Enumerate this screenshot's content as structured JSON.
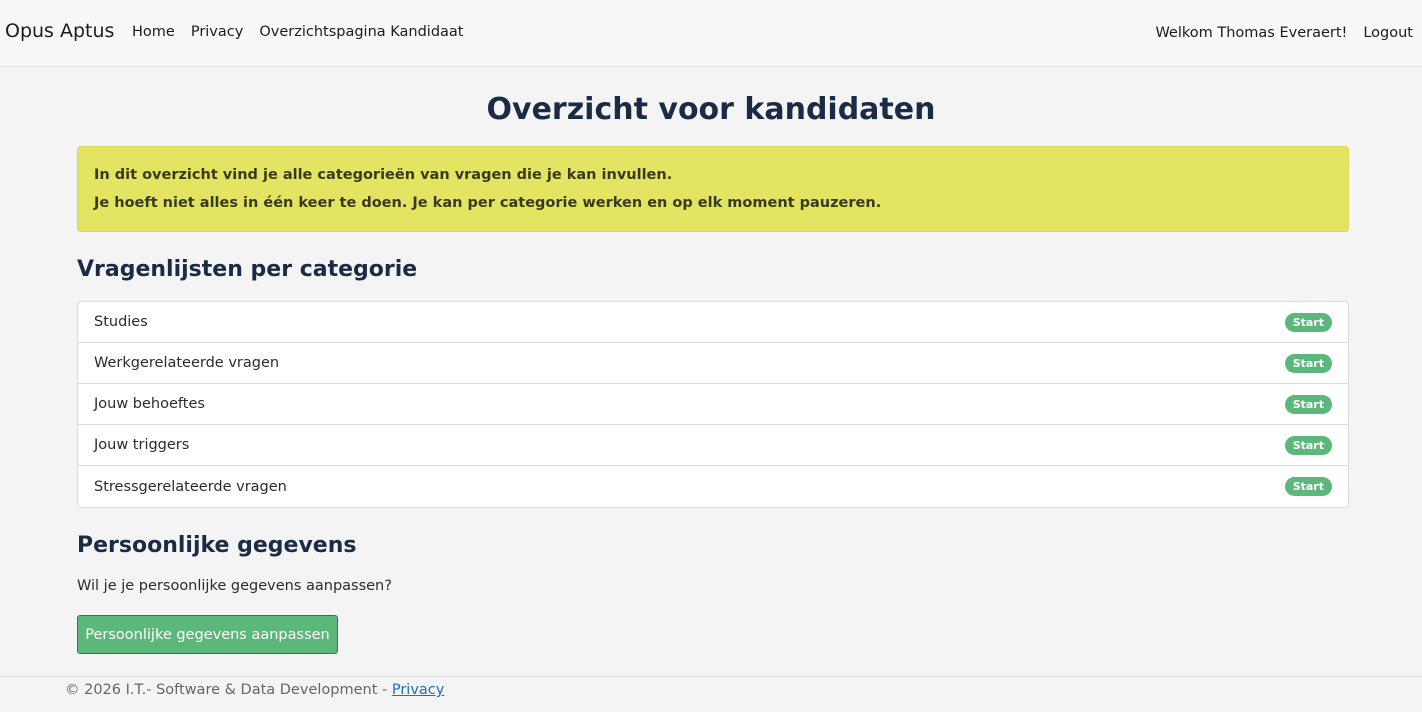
{
  "navbar": {
    "brand": "Opus Aptus",
    "links": [
      "Home",
      "Privacy",
      "Overzichtspagina Kandidaat"
    ],
    "welcome": "Welkom Thomas Everaert!",
    "logout": "Logout"
  },
  "main": {
    "title": "Overzicht voor kandidaten",
    "alert": {
      "line1": "In dit overzicht vind je alle categorieën van vragen die je kan invullen.",
      "line2": "Je hoeft niet alles in één keer te doen. Je kan per categorie werken en op elk moment pauzeren."
    },
    "categories_heading": "Vragenlijsten per categorie",
    "categories": [
      {
        "label": "Studies",
        "badge": "Start"
      },
      {
        "label": "Werkgerelateerde vragen",
        "badge": "Start"
      },
      {
        "label": "Jouw behoeftes",
        "badge": "Start"
      },
      {
        "label": "Jouw triggers",
        "badge": "Start"
      },
      {
        "label": "Stressgerelateerde vragen",
        "badge": "Start"
      }
    ],
    "personal_heading": "Persoonlijke gegevens",
    "personal_question": "Wil je je persoonlijke gegevens aanpassen?",
    "personal_button": "Persoonlijke gegevens aanpassen"
  },
  "footer": {
    "text": "© 2026 I.T.- Software & Data Development - ",
    "link": "Privacy"
  },
  "colors": {
    "alert_bg": "#e3e562",
    "badge_green": "#5cb87a",
    "heading": "#1c2b45"
  }
}
